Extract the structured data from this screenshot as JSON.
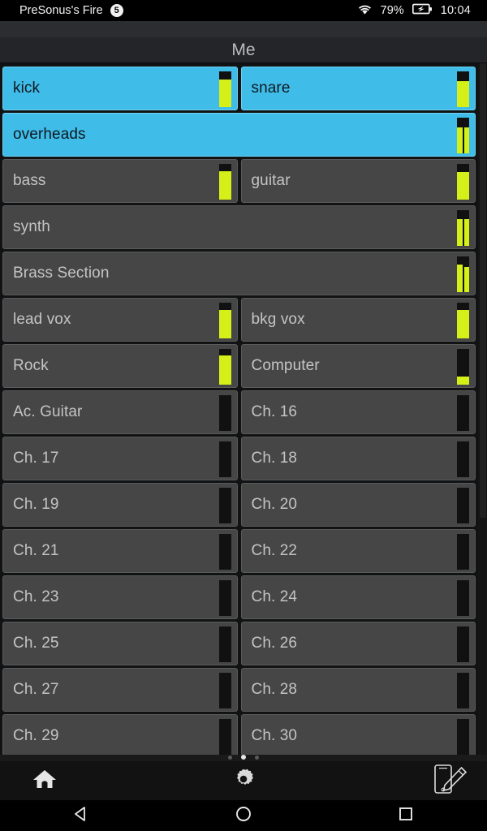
{
  "statusbar": {
    "app_name": "PreSonus's Fire",
    "notif_badge": "5",
    "wifi_icon": "wifi-icon",
    "battery_percent": "79%",
    "battery_icon": "battery-charging-icon",
    "time": "10:04"
  },
  "titlebar": {
    "title": "Me"
  },
  "colors": {
    "selected": "#3fbce8",
    "row": "#464646",
    "meter": "#d4f018",
    "text": "#c4c4c4"
  },
  "channels": [
    {
      "label": "kick",
      "width": "half",
      "selected": true,
      "meter": "mono",
      "levels": [
        78
      ]
    },
    {
      "label": "snare",
      "width": "half",
      "selected": true,
      "meter": "mono",
      "levels": [
        72
      ]
    },
    {
      "label": "overheads",
      "width": "full",
      "selected": true,
      "meter": "stereo",
      "levels": [
        72,
        72
      ]
    },
    {
      "label": "bass",
      "width": "half",
      "selected": false,
      "meter": "mono",
      "levels": [
        80
      ]
    },
    {
      "label": "guitar",
      "width": "half",
      "selected": false,
      "meter": "mono",
      "levels": [
        78
      ]
    },
    {
      "label": "synth",
      "width": "full",
      "selected": false,
      "meter": "stereo",
      "levels": [
        76,
        76
      ]
    },
    {
      "label": "Brass Section",
      "width": "full",
      "selected": false,
      "meter": "stereo",
      "levels": [
        78,
        70
      ]
    },
    {
      "label": "lead vox",
      "width": "half",
      "selected": false,
      "meter": "mono",
      "levels": [
        80
      ]
    },
    {
      "label": "bkg vox",
      "width": "half",
      "selected": false,
      "meter": "mono",
      "levels": [
        80
      ]
    },
    {
      "label": "Rock",
      "width": "half",
      "selected": false,
      "meter": "mono",
      "levels": [
        82
      ]
    },
    {
      "label": "Computer",
      "width": "half",
      "selected": false,
      "meter": "mono",
      "levels": [
        22
      ]
    },
    {
      "label": "Ac. Guitar",
      "width": "half",
      "selected": false,
      "meter": "mono",
      "levels": [
        0
      ]
    },
    {
      "label": "Ch. 16",
      "width": "half",
      "selected": false,
      "meter": "mono",
      "levels": [
        0
      ]
    },
    {
      "label": "Ch. 17",
      "width": "half",
      "selected": false,
      "meter": "mono",
      "levels": [
        0
      ]
    },
    {
      "label": "Ch. 18",
      "width": "half",
      "selected": false,
      "meter": "mono",
      "levels": [
        0
      ]
    },
    {
      "label": "Ch. 19",
      "width": "half",
      "selected": false,
      "meter": "mono",
      "levels": [
        0
      ]
    },
    {
      "label": "Ch. 20",
      "width": "half",
      "selected": false,
      "meter": "mono",
      "levels": [
        0
      ]
    },
    {
      "label": "Ch. 21",
      "width": "half",
      "selected": false,
      "meter": "mono",
      "levels": [
        0
      ]
    },
    {
      "label": "Ch. 22",
      "width": "half",
      "selected": false,
      "meter": "mono",
      "levels": [
        0
      ]
    },
    {
      "label": "Ch. 23",
      "width": "half",
      "selected": false,
      "meter": "mono",
      "levels": [
        0
      ]
    },
    {
      "label": "Ch. 24",
      "width": "half",
      "selected": false,
      "meter": "mono",
      "levels": [
        0
      ]
    },
    {
      "label": "Ch. 25",
      "width": "half",
      "selected": false,
      "meter": "mono",
      "levels": [
        0
      ]
    },
    {
      "label": "Ch. 26",
      "width": "half",
      "selected": false,
      "meter": "mono",
      "levels": [
        0
      ]
    },
    {
      "label": "Ch. 27",
      "width": "half",
      "selected": false,
      "meter": "mono",
      "levels": [
        0
      ]
    },
    {
      "label": "Ch. 28",
      "width": "half",
      "selected": false,
      "meter": "mono",
      "levels": [
        0
      ]
    },
    {
      "label": "Ch. 29",
      "width": "half",
      "selected": false,
      "meter": "mono",
      "levels": [
        0
      ]
    },
    {
      "label": "Ch. 30",
      "width": "half",
      "selected": false,
      "meter": "mono",
      "levels": [
        0
      ]
    }
  ],
  "pager": {
    "count": 3,
    "active_index": 1
  },
  "toolbar": {
    "home_icon": "home-icon",
    "settings_icon": "gear-icon",
    "device_icon": "device-pencil-icon"
  },
  "navbar": {
    "back_icon": "triangle-back-icon",
    "home_icon": "circle-home-icon",
    "recents_icon": "square-recents-icon"
  }
}
